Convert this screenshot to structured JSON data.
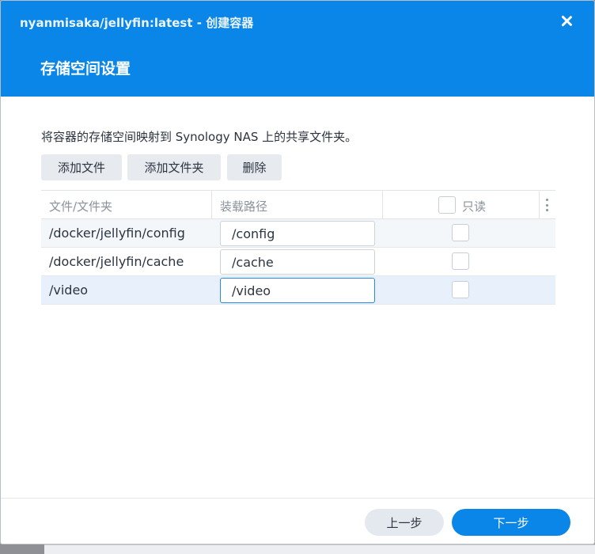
{
  "window": {
    "title": "nyanmisaka/jellyfin:latest - 创建容器",
    "close_icon": "close-icon"
  },
  "step": {
    "title": "存储空间设置"
  },
  "description": "将容器的存储空间映射到 Synology NAS 上的共享文件夹。",
  "toolbar": {
    "add_file": "添加文件",
    "add_folder": "添加文件夹",
    "delete": "删除"
  },
  "table": {
    "columns": {
      "file_folder": "文件/文件夹",
      "mount_path": "装载路径",
      "read_only": "只读"
    },
    "menu_icon": "vertical-ellipsis-icon",
    "rows": [
      {
        "source": "/docker/jellyfin/config",
        "mount": "/config",
        "read_only": false
      },
      {
        "source": "/docker/jellyfin/cache",
        "mount": "/cache",
        "read_only": false
      },
      {
        "source": "/video",
        "mount": "/video",
        "read_only": false
      }
    ]
  },
  "footer": {
    "prev": "上一步",
    "next": "下一步"
  },
  "colors": {
    "header": "#0986e8",
    "primary_button": "#0986e8",
    "focus_border": "#2a8ae0"
  }
}
